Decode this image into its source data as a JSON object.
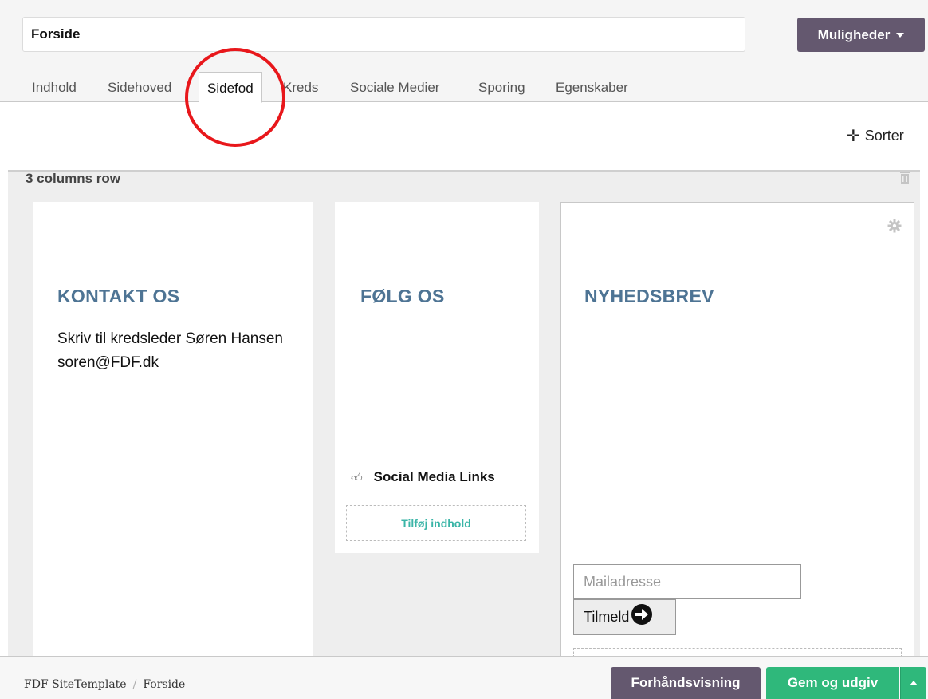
{
  "page_title_value": "Forside",
  "options_button": "Muligheder",
  "tabs": [
    {
      "label": "Indhold"
    },
    {
      "label": "Sidehoved"
    },
    {
      "label": "Sidefod",
      "active": true
    },
    {
      "label": "Kreds"
    },
    {
      "label": "Sociale Medier"
    },
    {
      "label": "Sporing"
    },
    {
      "label": "Egenskaber"
    }
  ],
  "sorter_label": "Sorter",
  "row_label": "3 columns row",
  "columns": {
    "contact": {
      "heading": "KONTAKT OS",
      "text": "Skriv til kredsleder Søren Hansen soren@FDF.dk"
    },
    "follow": {
      "heading": "FØLG OS",
      "social_links": "Social Media Links",
      "add_content": "Tilføj indhold"
    },
    "newsletter": {
      "heading": "NYHEDSBREV",
      "mail_placeholder": "Mailadresse",
      "signup_label": "Tilmeld"
    }
  },
  "breadcrumb": {
    "root": "FDF SiteTemplate",
    "separator": "/",
    "current": "Forside"
  },
  "footer_buttons": {
    "preview": "Forhåndsvisning",
    "publish": "Gem og udgiv"
  },
  "colors": {
    "accent_purple": "#64586f",
    "publish_green": "#2fb87b",
    "heading_blue": "#4e7494",
    "highlight_red": "#e8171b",
    "add_content_teal": "#3bb5a7"
  },
  "icons": {
    "options": "caret-down-icon",
    "sorter": "move-icon",
    "row_delete": "trash-icon",
    "column_settings": "gear-icon",
    "social": "thumbs-up-icon",
    "signup": "arrow-right-circle-icon",
    "publish_menu": "caret-up-icon"
  }
}
